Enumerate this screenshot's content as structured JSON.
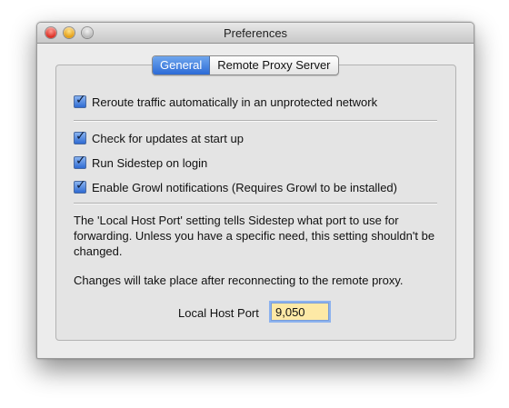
{
  "window": {
    "title": "Preferences"
  },
  "tabs": {
    "general": "General",
    "remote_proxy": "Remote Proxy Server"
  },
  "options": {
    "reroute": "Reroute traffic automatically in an unprotected network",
    "check_updates": "Check for updates at start up",
    "run_on_login": "Run Sidestep on login",
    "growl": "Enable Growl notifications (Requires Growl to be installed)"
  },
  "info": {
    "port_description": "The 'Local Host Port' setting tells Sidestep what port to use for forwarding.  Unless you have a specific need, this setting shouldn't be changed.",
    "reconnect_note": "Changes will take place after reconnecting to the remote proxy."
  },
  "port": {
    "label": "Local Host Port",
    "value": "9,050"
  },
  "colors": {
    "accent": "#2c6ad6",
    "field_highlight": "#fde9a6"
  }
}
